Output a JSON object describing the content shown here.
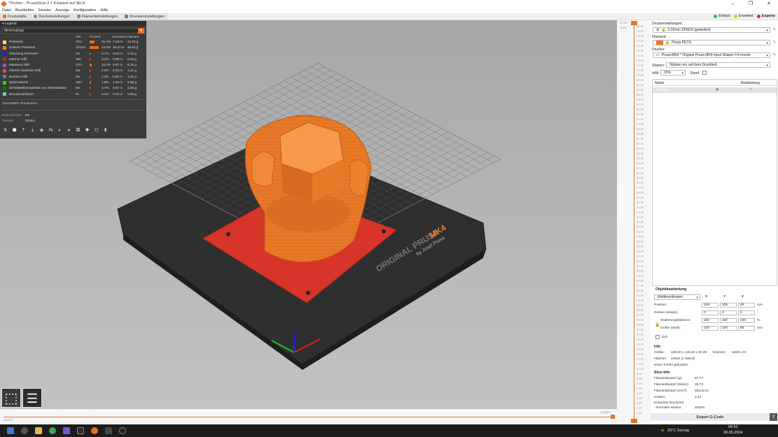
{
  "window": {
    "title": "*Trichter - PrusaSlicer-2.7.4 basiert auf Slic3r"
  },
  "menu": [
    "Datei",
    "Bearbeiten",
    "Fenster",
    "Anzeige",
    "Konfiguration",
    "Hilfe"
  ],
  "tabs": [
    "Druckplatte",
    "Druckeinstellungen",
    "Filamenteinstellungen",
    "Druckereinstellungen"
  ],
  "modes": [
    {
      "label": "Einfach",
      "color": "#3cb043"
    },
    {
      "label": "Erweitert",
      "color": "#f0c000"
    },
    {
      "label": "Experte",
      "color": "#e02020"
    }
  ],
  "legend": {
    "title": "Legend",
    "view_type": "Merkmalstyp",
    "columns": {
      "time": "Zeit",
      "percent": "Prozent",
      "filament": "Genutztes Filament"
    },
    "rows": [
      {
        "name": "Perimeter",
        "time": "37m",
        "pct": "21,7%",
        "len": "7.19 m",
        "wt": "21.92 g",
        "color": "#ffe64d",
        "frac": 0.217
      },
      {
        "name": "Äußerer Perimeter",
        "time": "1h12m",
        "pct": "43,0%",
        "len": "15.23 m",
        "wt": "46.52 g",
        "color": "#ff7d38",
        "frac": 0.43
      },
      {
        "name": "Überhang Perimeter",
        "time": "1m",
        "pct": "0,7%",
        "len": "0.03 m",
        "wt": "0.10 g",
        "color": "#1f1fff",
        "frac": 0.007
      },
      {
        "name": "Interner Infill",
        "time": "39s",
        "pct": "0,4%",
        "len": "0.08 m",
        "wt": "0.24 g",
        "color": "#b03029",
        "frac": 0.004
      },
      {
        "name": "Massives Infill",
        "time": "17m",
        "pct": "10,2%",
        "len": "2.67 m",
        "wt": "8.15 g",
        "color": "#9654cc",
        "frac": 0.102
      },
      {
        "name": "Oberes massives Infill",
        "time": "3m",
        "pct": "2,0%",
        "len": "0.43 m",
        "wt": "1.31 g",
        "color": "#f04040",
        "frac": 0.02
      },
      {
        "name": "Brücken Infill",
        "time": "4m",
        "pct": "2,3%",
        "len": "0.50 m",
        "wt": "1.52 g",
        "color": "#4d80ba",
        "frac": 0.023
      },
      {
        "name": "Stützmaterial",
        "time": "13m",
        "pct": "7,8%",
        "len": "1.93 m",
        "wt": "5.89 g",
        "color": "#00ff00",
        "frac": 0.078
      },
      {
        "name": "Schnittstellenmaterial zum Stützmaterial",
        "time": "6m",
        "pct": "3,7%",
        "len": "0.67 m",
        "wt": "2.05 g",
        "color": "#008000",
        "frac": 0.037
      },
      {
        "name": "Benutzerdefiniert",
        "time": "6s",
        "pct": "0,1%",
        "len": "0.02 m",
        "wt": "0.06 g",
        "color": "#5ed1c7",
        "frac": 0.001
      }
    ],
    "estimated_title": "Geschätzte Druckzeiten",
    "first_layer_label": "Erste Schicht:",
    "first_layer_value": "8m",
    "total_label": "Gesamt:",
    "total_value": "2h50m"
  },
  "bed": {
    "brand": "ORIGINAL PRUSA",
    "model": "MK4",
    "by": "by Josef Prusa"
  },
  "horizontal_slider": {
    "left": "186(0)",
    "right": "186981"
  },
  "layer_slider": {
    "top_value": "80,00",
    "top_index": "(449)",
    "ticks": [
      "80,00",
      "79,00",
      "78,00",
      "77,00",
      "76,00",
      "75,00",
      "74,00",
      "73,00",
      "72,00",
      "71,00",
      "70,00",
      "69,00",
      "68,00",
      "67,00",
      "66,00",
      "65,00",
      "64,00",
      "63,00",
      "62,00",
      "61,00",
      "60,00",
      "59,00",
      "58,00",
      "57,00",
      "56,00",
      "55,00",
      "54,00",
      "53,00",
      "52,00",
      "51,00",
      "50,00",
      "49,00",
      "48,00",
      "47,00",
      "46,00",
      "45,00",
      "44,00",
      "43,00",
      "42,00",
      "41,00",
      "40,00",
      "39,00",
      "38,00",
      "37,00",
      "36,00",
      "35,00",
      "34,00",
      "33,00",
      "32,00",
      "31,00",
      "30,00",
      "29,00",
      "28,00",
      "27,00",
      "26,00",
      "25,00",
      "24,00",
      "23,00",
      "22,00",
      "21,00",
      "20,00",
      "19,00",
      "18,00",
      "17,00",
      "16,00",
      "15,00",
      "14,00",
      "13,00",
      "12,00",
      "11,00",
      "10,00",
      "9,00",
      "8,00",
      "7,00",
      "6,00",
      "5,00",
      "4,00",
      "3,00",
      "2,00",
      "1,00"
    ]
  },
  "sidebar": {
    "print_settings_label": "Druckeinstellungen:",
    "print_settings_value": "0,20mm SPEED (geändert)",
    "filament_label": "Filament:",
    "filament_value": "Prusa PETG",
    "filament_color": "#ec7a1c",
    "printer_label": "Drucker:",
    "printer_value": "Prusa MK4 * Original Prusa MK4 Input Shaper 0.4 nozzle",
    "supports_label": "Stützen:",
    "supports_value": "Stützen nur auf dem Druckbett",
    "infill_label": "Infill:",
    "infill_value": "15%",
    "brim_label": "Rand:",
    "table_name_col": "Name",
    "table_edit_col": "Bearbeitung",
    "object_name": "Trichter",
    "object_manipulation_title": "Objektbearbeitung",
    "coord_value": "Weltkoordinaten",
    "axis_x": "X",
    "axis_y": "Y",
    "axis_z": "Z",
    "position_label": "Position:",
    "position": [
      "125",
      "105",
      "40"
    ],
    "rotation_label": "Drehen (relativ):",
    "rotation": [
      "0",
      "0",
      "0"
    ],
    "scale_label": "Skalierungsfaktoren:",
    "scale": [
      "100",
      "100",
      "100"
    ],
    "size_label": "Größe (Welt):",
    "size": [
      "120",
      "120",
      "80"
    ],
    "unit_mm": "mm",
    "unit_deg": "°",
    "unit_pct": "%",
    "inch_label": "Zoll",
    "info_title": "Info",
    "info_size_label": "Größe:",
    "info_size_value": "120,00 x 120,00 x 80,00",
    "info_volume_label": "Volumen:",
    "info_volume_value": "64841,23",
    "info_facets_label": "Flächen:",
    "info_facets_value": "44844 (1 Wand)",
    "info_errors": "Keine Fehler gefunden",
    "slice_title": "Slice-Info",
    "slice_rows": [
      {
        "label": "Filamentbedarf (g):",
        "value": "87,77"
      },
      {
        "label": "Filamentbedarf (Meter):",
        "value": "28,73"
      },
      {
        "label": "Filamentbedarf (mm³):",
        "value": "69113,03"
      },
      {
        "label": "Kosten:",
        "value": "2,44"
      }
    ],
    "est_time_label": "Erwartete Druckzeit:",
    "normal_mode_label": "- Normaler Modus:",
    "normal_mode_value": "2h50m",
    "export_label": "Export G-Code"
  },
  "taskbar": {
    "weather": "20°C Sonnig",
    "time": "09:52",
    "date": "28.05.2024"
  }
}
